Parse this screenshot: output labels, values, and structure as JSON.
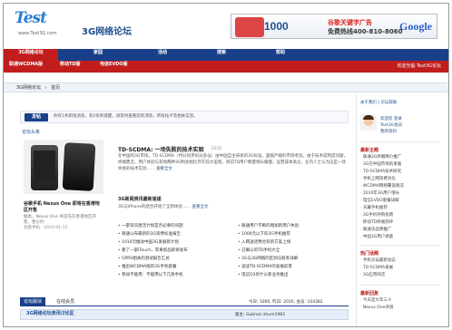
{
  "header": {
    "logo_text": "Test",
    "logo_url": "www.Test3G.com",
    "site_title": "3G网络论坛"
  },
  "ad": {
    "price": "1000",
    "line1": "谷歌关键字广告",
    "line2": "免费热线400-810-8060",
    "brand": "Google"
  },
  "nav": {
    "items": [
      "3G网络论坛",
      "家园",
      "活动",
      "搜索",
      "帮助"
    ]
  },
  "subnav": {
    "items": [
      "联通WCDMA版",
      "移动TD版",
      "电信EVDO版"
    ],
    "right": "欢迎光临 Test3G论坛"
  },
  "breadcrumb": {
    "items": [
      "3G网络论坛",
      "›",
      "首页"
    ]
  },
  "notice": {
    "button": "发帖",
    "text": "你有1条新短消息，有2条新提醒，请及时查看您的消息，所有帖子及相关信息。"
  },
  "section_label": "论坛头条",
  "product": {
    "title": "谷歌手机 Nexus One 即将在香港地区开售",
    "desc": "据悉，Nexus One 将首先在香港地区开售，售价约",
    "meta": "谷歌手机 · 2010-01-11"
  },
  "featured": {
    "title": "TD-SCDMA: 一场失败的技术实验",
    "time": "3天前",
    "body": "在中国的3G市场，TD-SCDMA（时分同步码分多址）由中国自主研发的3G标准，面临严峻的市场考验。由于技术成熟度问题，终端匮乏，用户体验与其他两种3G制式相比存在较大差距。目前TD用户数量增长缓慢，运营成本高企，业内人士认为这是一场失败的技术实验……",
    "more": "查看全文"
  },
  "item": {
    "title": "3G新闻资讯最新速递",
    "body": "3G与iPhone的结合开始了全新体验……",
    "more": "查看全文"
  },
  "links": [
    [
      "一部资讯激活计划是否必要的问题",
      "联通用户不断的增加新用户体验"
    ],
    [
      "联通公布最新的3G资费标准报告",
      "1000元以下的3G手机推荐"
    ],
    [
      "1010元推动中国3G发展新计划",
      "入网送话费也有新方案上线"
    ],
    [
      "看了一部iTouch，苹果新品即将发布",
      "已确认的TD手机大全"
    ],
    [
      "GPRS相关的测试报告汇总",
      "2G与3G网络的区别与联系详解"
    ],
    [
      "推出WCDMA版的3G手机套餐",
      "谈谈TD-SCDMA的发展前景"
    ],
    [
      "移动不能用：不能用以下几款手机",
      "电信Q3有什么新业务推出"
    ]
  ],
  "tabs": {
    "items": [
      "论坛版块",
      "在线会员"
    ],
    "stats": "今日: 1060, 昨日: 2016, 会员: 104382"
  },
  "forum_row": {
    "name": "3G网络论坛资讯讨论区",
    "mods": "版主: Gubnan  zhum1983"
  },
  "sidebar": {
    "top": "关于我们 | 论坛帮助",
    "user_lines": [
      "欢迎您 登录",
      "Test3G会员",
      "我的资料"
    ],
    "heads": [
      "最新主题",
      "热门话题",
      "最新回复"
    ],
    "list1": [
      "联通3G终端降价推广",
      "3G在中国市场的发展",
      "TD-SCDMA技术研究",
      "手机上网资费对比",
      "WCDMA网络覆盖情况",
      "2010年3G用户增长",
      "电信EVDO套餐详解",
      "天翼手机推荐",
      "3G手机导购指南",
      "移动TD终端测评",
      "联通沃品牌推广",
      "中国3G用户调查"
    ],
    "list2": [
      "手机论坛最新动态",
      "TD-SCDMA发展",
      "3G应用商店"
    ],
    "list3": [
      "今天是大年三十",
      "Nexus One评测"
    ]
  }
}
